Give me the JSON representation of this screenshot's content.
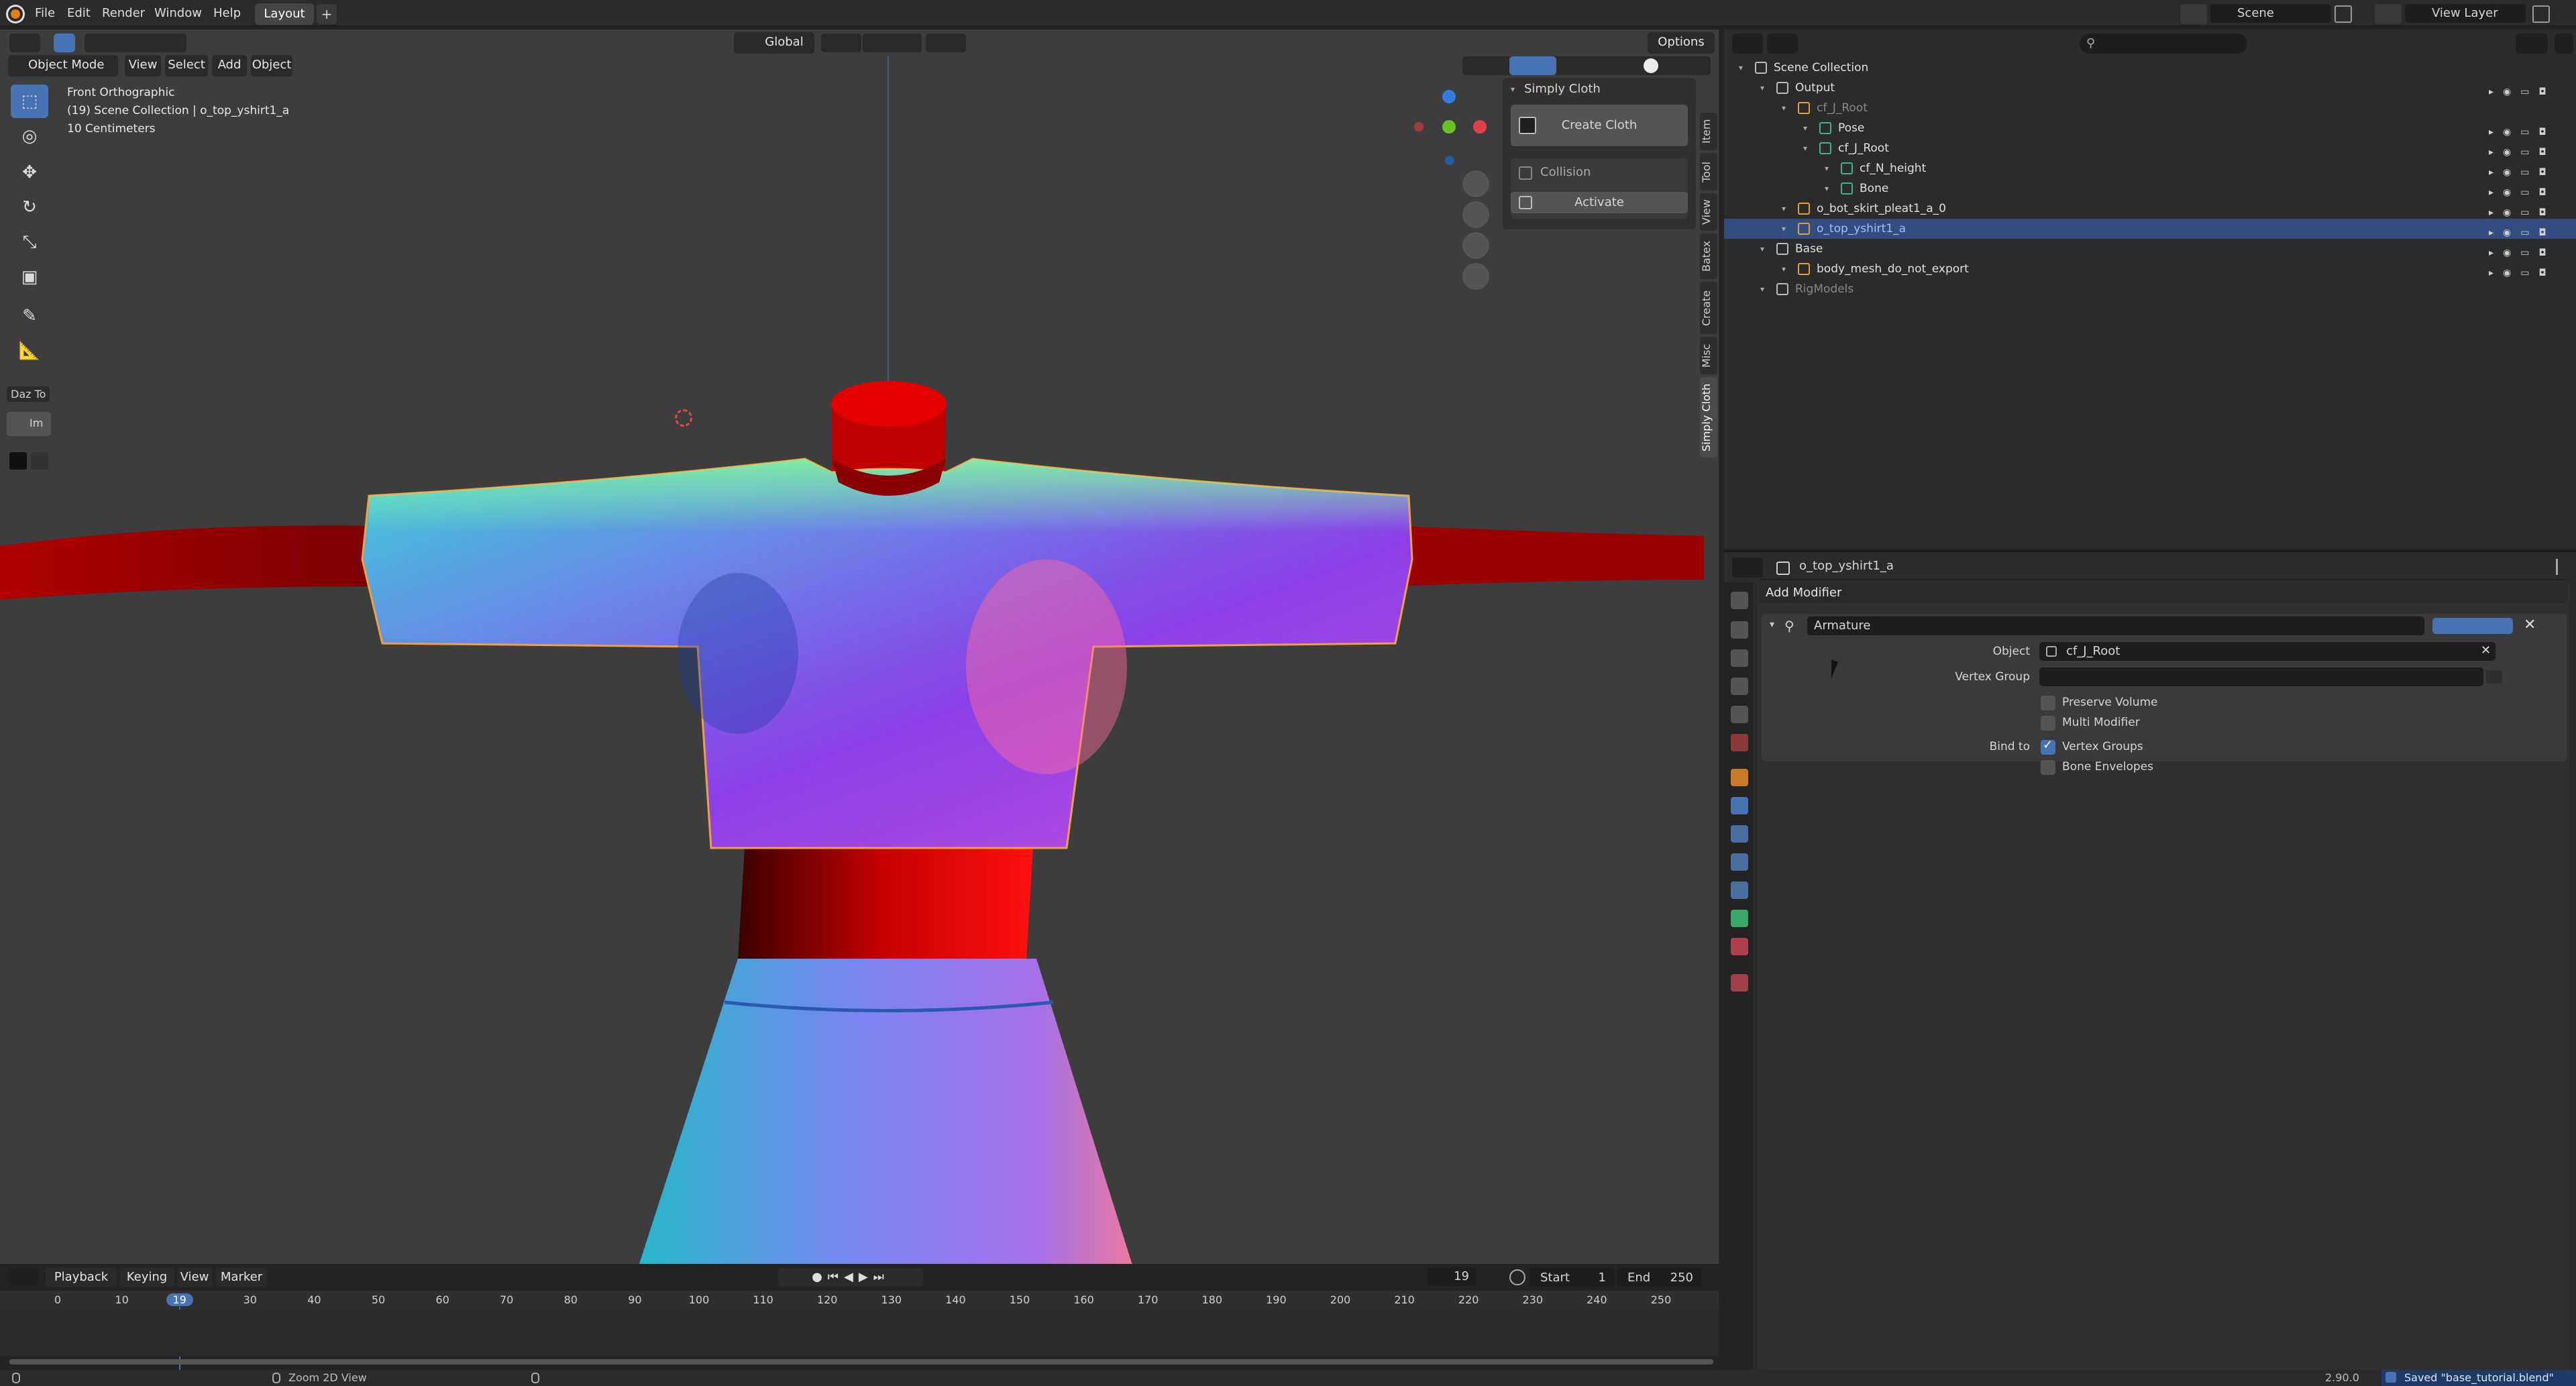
{
  "topbar": {
    "menus": [
      "File",
      "Edit",
      "Render",
      "Window",
      "Help"
    ],
    "workspace_tab": "Layout",
    "scene": "Scene",
    "view_layer": "View Layer"
  },
  "viewport_header": {
    "transform_orientation": "Global",
    "options_label": "Options",
    "mode": "Object Mode",
    "menus": [
      "View",
      "Select",
      "Add",
      "Object"
    ]
  },
  "viewport_overlay": {
    "view_name": "Front Orthographic",
    "collection_info": "(19) Scene Collection | o_top_yshirt1_a",
    "scale": "10 Centimeters"
  },
  "side_addon": {
    "label": "Daz To",
    "button": "Im"
  },
  "simply_cloth": {
    "title": "Simply Cloth",
    "create_button": "Create Cloth",
    "collision_label": "Collision",
    "activate_button": "Activate"
  },
  "npanel_tabs": [
    "Item",
    "Tool",
    "View",
    "Batex",
    "Create",
    "Misc",
    "Simply Cloth"
  ],
  "outliner": {
    "rows": [
      {
        "label": "Scene Collection",
        "indent": 0
      },
      {
        "label": "Output",
        "indent": 1
      },
      {
        "label": "cf_J_Root",
        "indent": 2,
        "dim": true
      },
      {
        "label": "Pose",
        "indent": 3
      },
      {
        "label": "cf_J_Root",
        "indent": 3
      },
      {
        "label": "cf_N_height",
        "indent": 4
      },
      {
        "label": "Bone",
        "indent": 4
      },
      {
        "label": "o_bot_skirt_pleat1_a_0",
        "indent": 2
      },
      {
        "label": "o_top_yshirt1_a",
        "indent": 2,
        "selected": true
      },
      {
        "label": "Base",
        "indent": 1
      },
      {
        "label": "body_mesh_do_not_export",
        "indent": 2
      },
      {
        "label": "RigModels",
        "indent": 1,
        "dim": true
      }
    ]
  },
  "properties": {
    "object_name": "o_top_yshirt1_a",
    "add_modifier": "Add Modifier",
    "modifier_name": "Armature",
    "object_label": "Object",
    "object_value": "cf_J_Root",
    "vertex_group_label": "Vertex Group",
    "preserve_volume": "Preserve Volume",
    "multi_modifier": "Multi Modifier",
    "bind_to_label": "Bind to",
    "vertex_groups": "Vertex Groups",
    "bone_envelopes": "Bone Envelopes"
  },
  "timeline": {
    "menus": [
      "Playback",
      "Keying",
      "View",
      "Marker"
    ],
    "current_frame": "19",
    "start_label": "Start",
    "start": "1",
    "end_label": "End",
    "end": "250",
    "ticks": [
      "0",
      "10",
      "19",
      "30",
      "40",
      "50",
      "60",
      "70",
      "80",
      "90",
      "100",
      "110",
      "120",
      "130",
      "140",
      "150",
      "160",
      "170",
      "180",
      "190",
      "200",
      "210",
      "220",
      "230",
      "240",
      "250"
    ]
  },
  "statusbar": {
    "hint": "Zoom 2D View",
    "version": "2.90.0",
    "saved": "Saved \"base_tutorial.blend\""
  },
  "colors": {
    "accent": "#4772b3",
    "selected_row": "#334d80",
    "panel": "#2b2b2b",
    "viewport": "#3d3d3d"
  }
}
